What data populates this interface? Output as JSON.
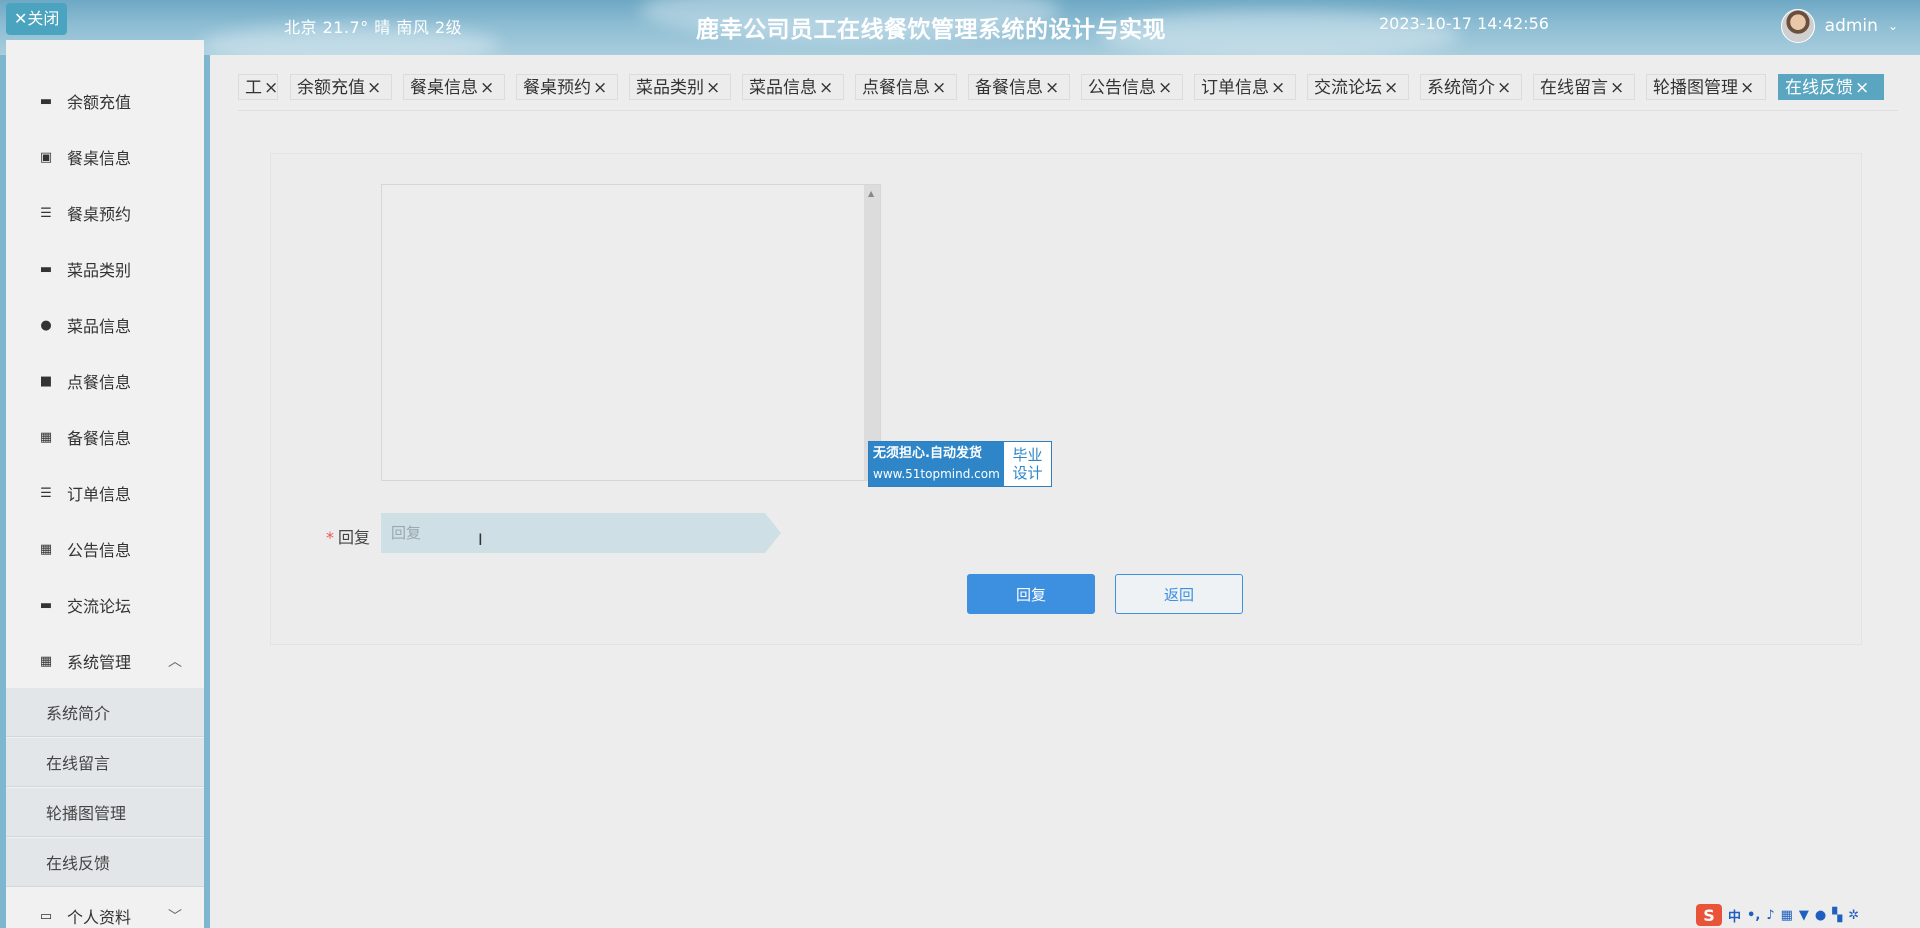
{
  "header": {
    "close_label": "✕关闭",
    "weather": "北京  21.7°  晴  南风  2级",
    "title": "鹿幸公司员工在线餐饮管理系统的设计与实现",
    "datetime": "2023-10-17 14:42:56",
    "username": "admin"
  },
  "sidebar": {
    "items": [
      {
        "label": "余额充值",
        "icon": "chat-icon"
      },
      {
        "label": "餐桌信息",
        "icon": "clipboard-icon"
      },
      {
        "label": "餐桌预约",
        "icon": "list-icon"
      },
      {
        "label": "菜品类别",
        "icon": "monitor-icon"
      },
      {
        "label": "菜品信息",
        "icon": "leaf-icon"
      },
      {
        "label": "点餐信息",
        "icon": "cart-icon"
      },
      {
        "label": "备餐信息",
        "icon": "grid-icon"
      },
      {
        "label": "订单信息",
        "icon": "lines-icon"
      },
      {
        "label": "公告信息",
        "icon": "grid-icon"
      },
      {
        "label": "交流论坛",
        "icon": "monitor-icon"
      },
      {
        "label": "系统管理",
        "icon": "grid-icon"
      }
    ],
    "submenu": [
      {
        "label": "系统简介"
      },
      {
        "label": "在线留言"
      },
      {
        "label": "轮播图管理"
      },
      {
        "label": "在线反馈"
      }
    ],
    "profile": {
      "label": "个人资料",
      "icon": "calendar-icon"
    }
  },
  "tabs": [
    {
      "label": "工"
    },
    {
      "label": "余额充值"
    },
    {
      "label": "餐桌信息"
    },
    {
      "label": "餐桌预约"
    },
    {
      "label": "菜品类别"
    },
    {
      "label": "菜品信息"
    },
    {
      "label": "点餐信息"
    },
    {
      "label": "备餐信息"
    },
    {
      "label": "公告信息"
    },
    {
      "label": "订单信息"
    },
    {
      "label": "交流论坛"
    },
    {
      "label": "系统简介"
    },
    {
      "label": "在线留言"
    },
    {
      "label": "轮播图管理"
    },
    {
      "label": "在线反馈",
      "active": true
    }
  ],
  "form": {
    "reply_label": "回复",
    "reply_placeholder": "回复",
    "submit_label": "回复",
    "back_label": "返回"
  },
  "watermark": {
    "line1": "无须担心.自动发货",
    "url": "www.51topmind.com",
    "side1": "毕业",
    "side2": "设计"
  },
  "tray": {
    "ime": "S",
    "ime_mode": "中"
  },
  "colors": {
    "accent": "#5aa6c0",
    "primary_button": "#3d8fe0",
    "header_bg": "#8dbdd3"
  }
}
